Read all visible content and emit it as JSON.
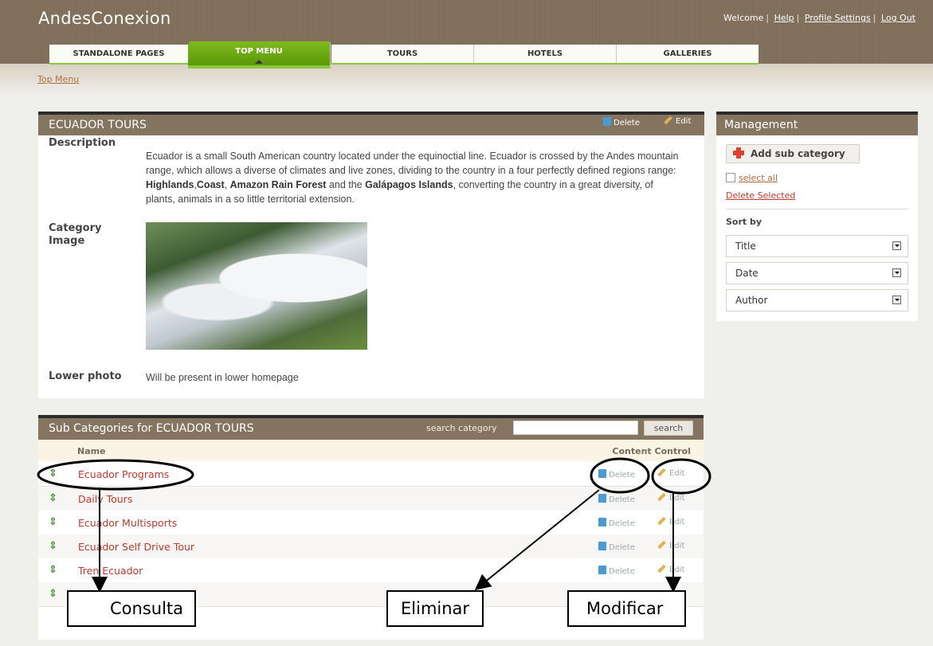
{
  "app": {
    "title": "AndesConexion"
  },
  "header": {
    "welcome": "Welcome",
    "help": "Help",
    "profile": "Profile Settings",
    "logout": "Log Out"
  },
  "tabs": [
    {
      "label": "STANDALONE PAGES",
      "active": false
    },
    {
      "label": "TOP MENU",
      "active": true
    },
    {
      "label": "TOURS",
      "active": false
    },
    {
      "label": "HOTELS",
      "active": false
    },
    {
      "label": "GALLERIES",
      "active": false
    }
  ],
  "breadcrumb": "Top Menu",
  "category": {
    "title": "ECUADOR TOURS",
    "delete_label": "Delete",
    "edit_label": "Edit",
    "description_label": "Description",
    "description_1": "Ecuador is a small South American country located under the equinoctial line. Ecuador is crossed by the Andes mountain range, which allows a diverse of climates and live zones, dividing to the country in a four perfectly defined regions range: ",
    "b1": "Highlands",
    "sep1": ",",
    "b2": "Coast",
    "sep2": ", ",
    "b3": "Amazon Rain Forest",
    "sep3": " and the ",
    "b4": "Galápagos Islands",
    "description_2": ", converting the country in a great diversity, of plants, animals in a so little territorial extension.",
    "image_label_1": "Category",
    "image_label_2": "Image",
    "lower_label": "Lower photo",
    "lower_value": "Will be present in lower homepage"
  },
  "subcategories": {
    "title": "Sub Categories for ECUADOR TOURS",
    "search_label": "search category",
    "search_value": "",
    "search_button": "search",
    "col_name": "Name",
    "col_control": "Content Control",
    "delete_label": "Delete",
    "edit_label": "Edit",
    "rows": [
      {
        "name": "Ecuador Programs"
      },
      {
        "name": "Daily Tours"
      },
      {
        "name": "Ecuador Multisports"
      },
      {
        "name": "Ecuador Self Drive Tour"
      },
      {
        "name": "Tren Ecuador"
      },
      {
        "name": ""
      }
    ]
  },
  "management": {
    "title": "Management",
    "add_button": "Add sub category",
    "select_all": "select all",
    "delete_selected": "Delete Selected",
    "sort_by": "Sort by",
    "sort_options": [
      "Title",
      "Date",
      "Author"
    ]
  },
  "annotations": {
    "consulta": "Consulta",
    "eliminar": "Eliminar",
    "modificar": "Modificar"
  }
}
